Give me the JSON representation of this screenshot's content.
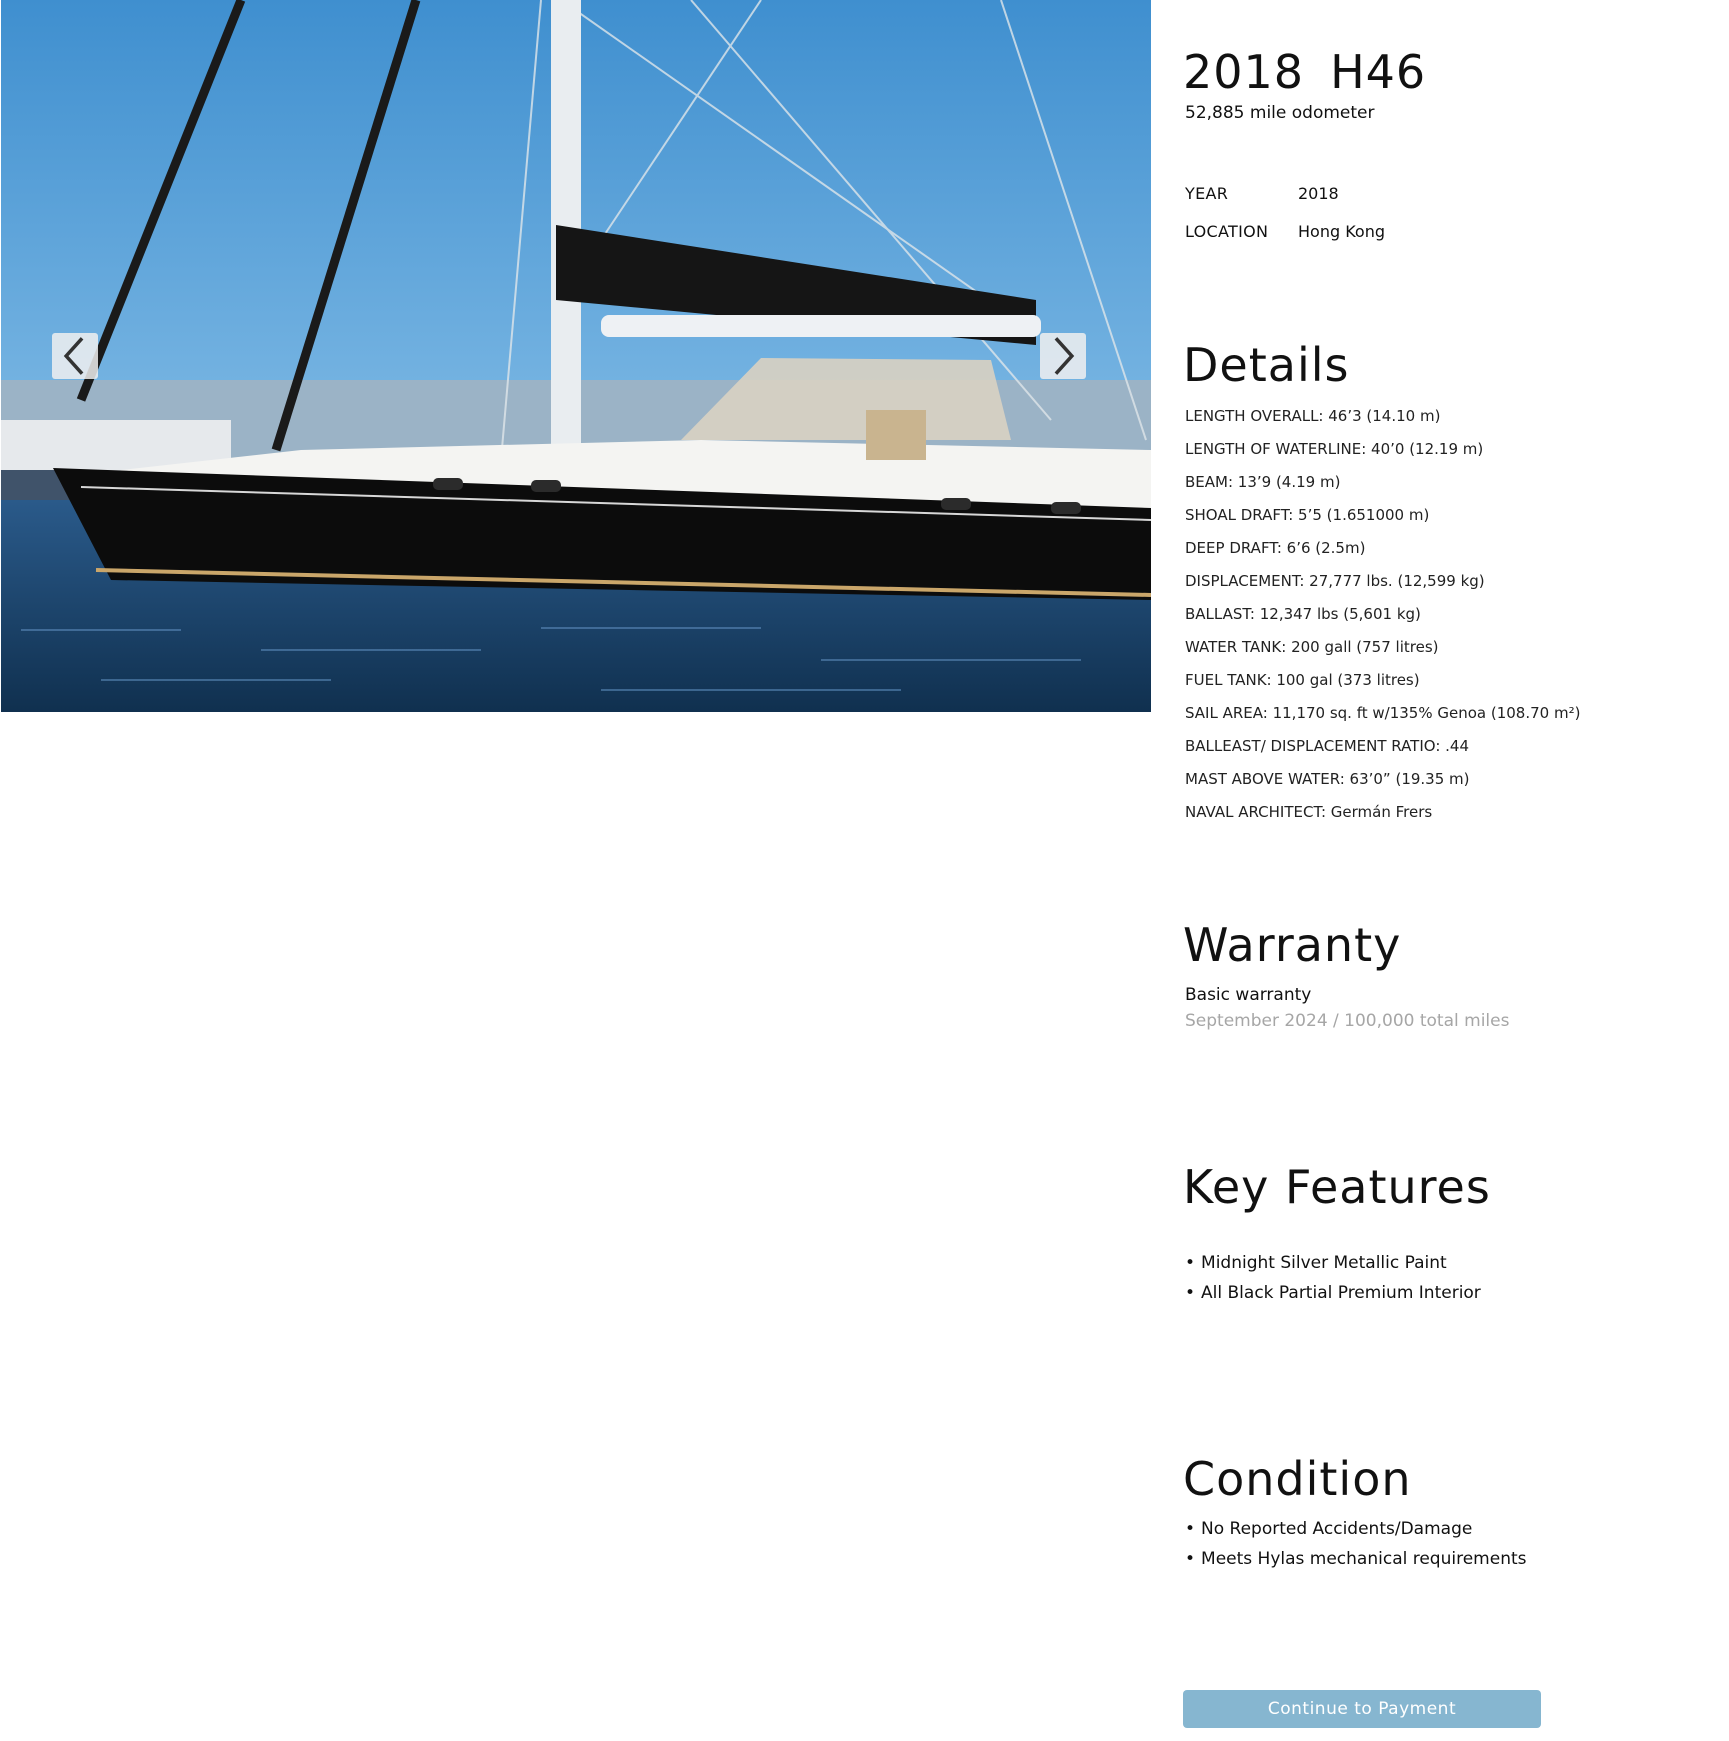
{
  "listing": {
    "year": "2018",
    "model": "H46",
    "odometer": "52,885 mile odometer"
  },
  "specs": {
    "year_label": "YEAR",
    "year_value": "2018",
    "location_label": "LOCATION",
    "location_value": "Hong Kong"
  },
  "details": {
    "heading": "Details",
    "items": [
      "LENGTH OVERALL: 46’3   (14.10 m)",
      "LENGTH OF WATERLINE: 40’0  (12.19 m)",
      "BEAM: 13’9 (4.19 m)",
      "SHOAL DRAFT: 5’5   (1.651000 m)",
      "DEEP DRAFT: 6’6 (2.5m)",
      "DISPLACEMENT: 27,777 lbs. (12,599 kg)",
      "BALLAST: 12,347 lbs (5,601 kg)",
      "WATER TANK: 200 gall (757 litres)",
      "FUEL TANK: 100 gal (373 litres)",
      "SAIL AREA: 11,170 sq. ft w/135% Genoa (108.70 m²)",
      "BALLEAST/ DISPLACEMENT RATIO: .44",
      "MAST ABOVE WATER: 63’0”   (19.35 m)",
      "NAVAL ARCHITECT: Germán Frers"
    ]
  },
  "warranty": {
    "heading": "Warranty",
    "type": "Basic warranty",
    "term": "September 2024 / 100,000 total miles"
  },
  "key_features": {
    "heading": "Key Features",
    "items": [
      "Midnight Silver Metallic Paint",
      "All Black Partial Premium Interior"
    ]
  },
  "condition": {
    "heading": "Condition",
    "items": [
      "No Reported Accidents/Damage",
      "Meets Hylas mechanical requirements"
    ]
  },
  "actions": {
    "continue_label": "Continue to Payment"
  },
  "gallery": {
    "prev_icon": "chevron-left-icon",
    "next_icon": "chevron-right-icon"
  },
  "colors": {
    "button_bg": "#86b6d0",
    "muted_text": "#a6a6a6"
  }
}
